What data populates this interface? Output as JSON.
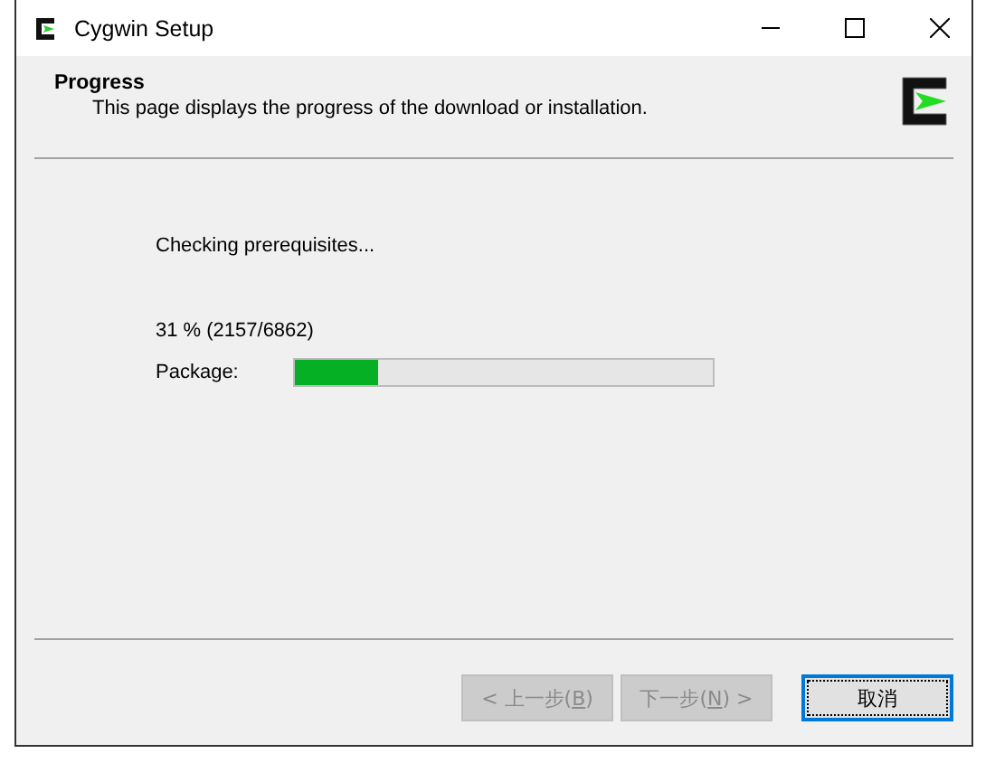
{
  "window": {
    "title": "Cygwin Setup"
  },
  "header": {
    "title": "Progress",
    "subtitle": "This page displays the progress of the download or installation."
  },
  "status": "Checking prerequisites...",
  "overall": "31 %  (2157/6862)",
  "package": {
    "label": "Package:",
    "level": 0.2
  },
  "buttons": [
    {
      "kind": "back",
      "prefix": "< 上一步(",
      "key": "B",
      "suffix": ")",
      "disabled": true,
      "focused": false
    },
    {
      "kind": "next",
      "prefix": "下一步(",
      "key": "N",
      "suffix": ")  >",
      "disabled": true,
      "focused": false
    },
    {
      "kind": "cancel",
      "prefix": "取消",
      "disabled": false,
      "focused": true
    }
  ]
}
